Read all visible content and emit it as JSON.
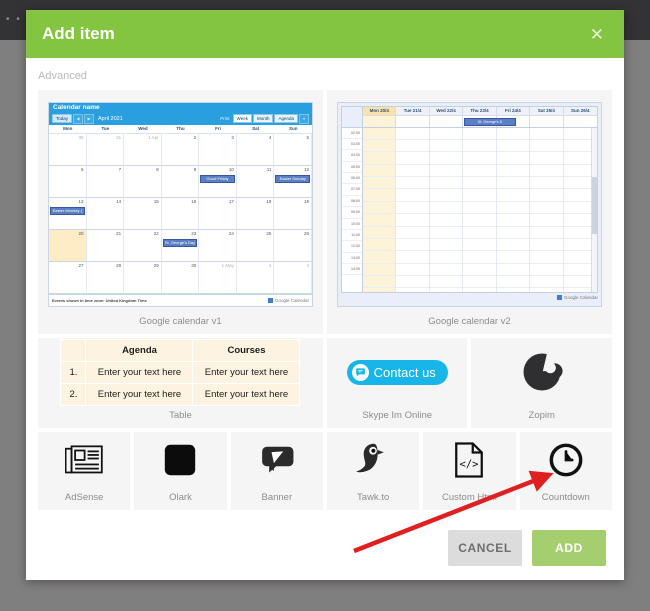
{
  "modal": {
    "title": "Add item",
    "close_icon": "close-icon",
    "section_label": "Advanced",
    "footer": {
      "cancel_label": "CANCEL",
      "add_label": "ADD"
    },
    "colors": {
      "header_green": "#83c441",
      "add_button_green": "#a5ce6e",
      "cancel_grey": "#dcdcdc",
      "tile_background": "#f5f5f5",
      "overlay": "#807f7f"
    }
  },
  "items": [
    {
      "id": "google-calendar-v1",
      "caption": "Google calendar v1"
    },
    {
      "id": "google-calendar-v2",
      "caption": "Google calendar v2"
    },
    {
      "id": "table",
      "caption": "Table"
    },
    {
      "id": "skype-im-online",
      "caption": "Skype Im Online"
    },
    {
      "id": "zopim",
      "caption": "Zopim"
    },
    {
      "id": "adsense",
      "caption": "AdSense"
    },
    {
      "id": "banner",
      "caption": "Banner"
    },
    {
      "id": "olark",
      "caption": "Olark"
    },
    {
      "id": "tawk-to",
      "caption": "Tawk.to"
    },
    {
      "id": "custom-html",
      "caption": "Custom Html"
    },
    {
      "id": "countdown",
      "caption": "Countdown"
    }
  ],
  "calendar_v1": {
    "name": "Calendar name",
    "today_label": "Today",
    "prev_label": "◀",
    "next_label": "▶",
    "date_range": "April 2021",
    "print_label": "Print",
    "views": [
      "Week",
      "Month",
      "Agenda"
    ],
    "selected_view": "Month",
    "weekdays": [
      "Mon",
      "Tue",
      "Wed",
      "Thu",
      "Fri",
      "Sat",
      "Sun"
    ],
    "weeks": [
      [
        {
          "num": "30",
          "dim": true
        },
        {
          "num": "31",
          "dim": true
        },
        {
          "num": "1 Apr",
          "dim": true
        },
        {
          "num": "2"
        },
        {
          "num": "3"
        },
        {
          "num": "4"
        },
        {
          "num": "5"
        }
      ],
      [
        {
          "num": "6"
        },
        {
          "num": "7"
        },
        {
          "num": "8"
        },
        {
          "num": "9"
        },
        {
          "num": "10",
          "event": "Good Friday"
        },
        {
          "num": "11"
        },
        {
          "num": "12",
          "event": "Easter Sunday"
        }
      ],
      [
        {
          "num": "13",
          "event": "Easter Monday ("
        },
        {
          "num": "14"
        },
        {
          "num": "15"
        },
        {
          "num": "16"
        },
        {
          "num": "17"
        },
        {
          "num": "18"
        },
        {
          "num": "19"
        }
      ],
      [
        {
          "num": "20",
          "today": true
        },
        {
          "num": "21"
        },
        {
          "num": "22"
        },
        {
          "num": "23",
          "event": "St. George's Day"
        },
        {
          "num": "24"
        },
        {
          "num": "25"
        },
        {
          "num": "26"
        }
      ],
      [
        {
          "num": "27"
        },
        {
          "num": "28"
        },
        {
          "num": "29"
        },
        {
          "num": "30"
        },
        {
          "num": "1 May",
          "dim": true
        },
        {
          "num": "2",
          "dim": true
        },
        {
          "num": "3",
          "dim": true
        }
      ]
    ],
    "timezone_note": "Events shown in time zone: United Kingdom Time",
    "logo_text": "Google Calendar"
  },
  "calendar_v2": {
    "days": [
      {
        "label": "Mon 20/4",
        "today": true
      },
      {
        "label": "Tue 21/4"
      },
      {
        "label": "Wed 22/4"
      },
      {
        "label": "Thu 23/4",
        "event": "St. George's D"
      },
      {
        "label": "Fri 24/4"
      },
      {
        "label": "Sat 25/4"
      },
      {
        "label": "Sun 26/4"
      }
    ],
    "times": [
      "02:00",
      "03:00",
      "04:00",
      "05:00",
      "06:00",
      "07:00",
      "08:00",
      "09:00",
      "10:00",
      "11:00",
      "12:00",
      "13:00",
      "14:00"
    ],
    "logo_text": "Google Calendar"
  },
  "table_widget": {
    "columns": [
      "",
      "Agenda",
      "Courses"
    ],
    "rows": [
      {
        "index": "1.",
        "agenda": "Enter your text here",
        "courses": "Enter your text here"
      },
      {
        "index": "2.",
        "agenda": "Enter your text here",
        "courses": "Enter your text here"
      }
    ]
  },
  "skype_widget": {
    "button_label": "Contact us",
    "icon": "chat-bubble-icon",
    "color": "#18b6e8"
  },
  "annotation": {
    "arrow_color": "#e02020",
    "points_to": "countdown"
  }
}
